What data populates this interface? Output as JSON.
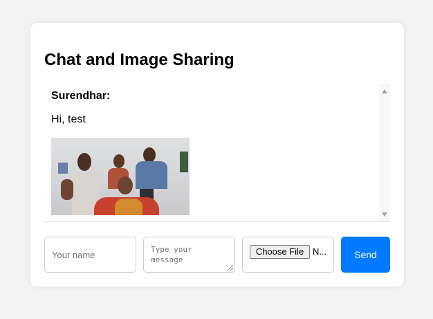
{
  "title": "Chat and Image Sharing",
  "messages": [
    {
      "sender": "Surendhar:",
      "text": "Hi, test",
      "has_image": true
    }
  ],
  "form": {
    "name_placeholder": "Your name",
    "message_placeholder": "Type your message",
    "file_button_label": "Choose File",
    "file_status": "N...",
    "send_label": "Send"
  },
  "colors": {
    "page_background": "#f3f3f3",
    "card_background": "#ffffff",
    "accent": "#007bff"
  }
}
